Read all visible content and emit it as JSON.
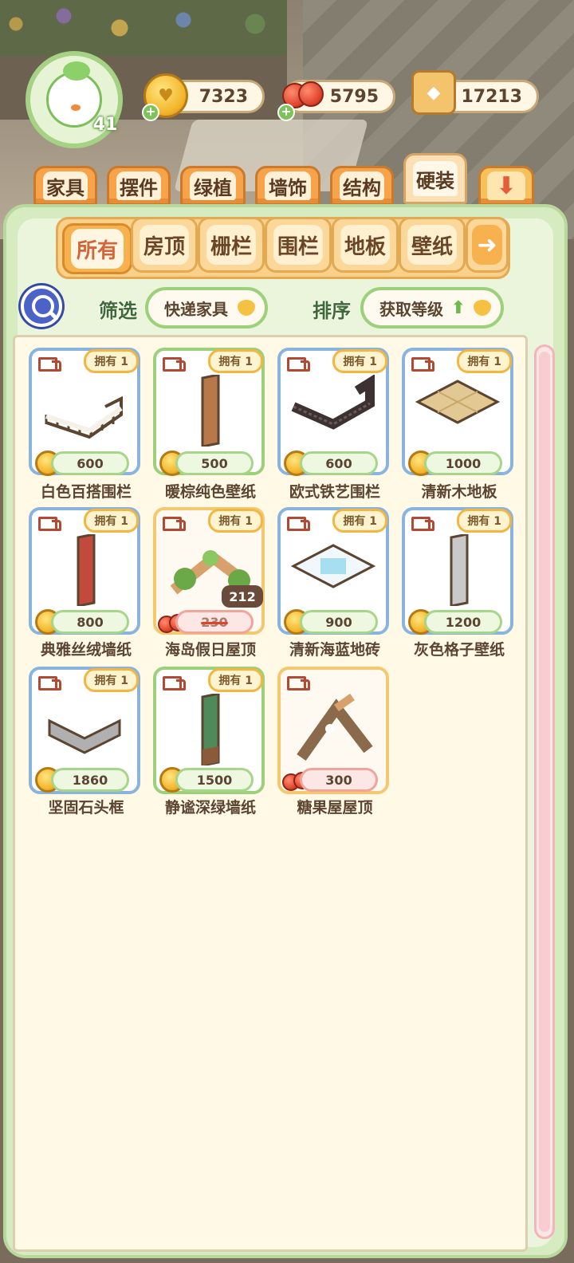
{
  "hud": {
    "level": "41",
    "coins": "7323",
    "cherries": "5795",
    "books": "17213"
  },
  "categories": [
    "家具",
    "摆件",
    "绿植",
    "墙饰",
    "结构",
    "硬装"
  ],
  "active_category": "硬装",
  "sub_tabs": [
    "所有",
    "房顶",
    "栅栏",
    "围栏",
    "地板",
    "壁纸"
  ],
  "active_sub_tab": "所有",
  "controls": {
    "filter_label": "筛选",
    "filter_value": "快递家具",
    "sort_label": "排序",
    "sort_value": "获取等级"
  },
  "items": [
    {
      "name": "白色百搭围栏",
      "owned": "拥有 1",
      "price": "600"
    },
    {
      "name": "暖棕纯色壁纸",
      "owned": "拥有 1",
      "price": "500"
    },
    {
      "name": "欧式铁艺围栏",
      "owned": "拥有 1",
      "price": "600"
    },
    {
      "name": "清新木地板",
      "owned": "拥有 1",
      "price": "1000"
    },
    {
      "name": "典雅丝绒墙纸",
      "owned": "拥有 1",
      "price": "800"
    },
    {
      "name": "海岛假日屋顶",
      "owned": "拥有 1",
      "price": "230",
      "discount": "212"
    },
    {
      "name": "清新海蓝地砖",
      "owned": "拥有 1",
      "price": "900"
    },
    {
      "name": "灰色格子壁纸",
      "owned": "拥有 1",
      "price": "1200"
    },
    {
      "name": "坚固石头框",
      "owned": "拥有 1",
      "price": "1860"
    },
    {
      "name": "静谧深绿墙纸",
      "owned": "拥有 1",
      "price": "1500"
    },
    {
      "name": "糖果屋屋顶",
      "price": "300"
    }
  ],
  "icons": {
    "coin": "coin-icon",
    "cherry": "cherry-icon",
    "book": "book-icon",
    "truck": "delivery-truck-icon",
    "search": "search-icon",
    "arrow_right": "arrow-right-icon",
    "arrow_down": "arrow-down-icon"
  },
  "colors": {
    "panel_green": "#d6ecc0",
    "tab_orange": "#f6a34a",
    "card_blue": "#89b4dd",
    "card_gold": "#f3c86f"
  }
}
